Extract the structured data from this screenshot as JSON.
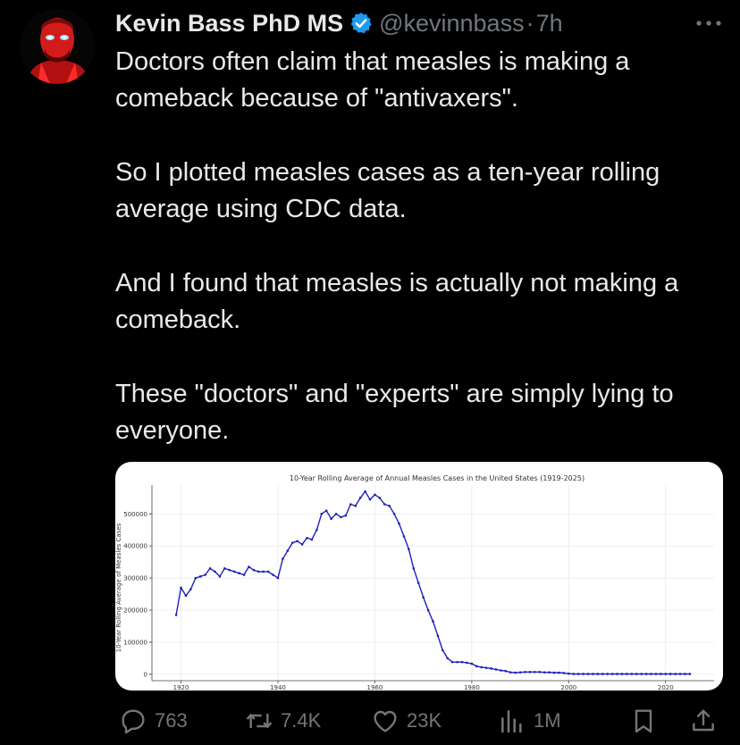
{
  "tweet": {
    "author_name": "Kevin Bass PhD MS",
    "handle": "@kevinnbass",
    "separator": "·",
    "time": "7h",
    "paragraphs": [
      "Doctors often claim that measles is making a comeback because of \"antivaxers\".",
      "So I plotted measles cases as a ten-year rolling average using CDC data.",
      "And I found that measles is actually not making a comeback.",
      "These \"doctors\" and \"experts\" are simply lying to everyone."
    ]
  },
  "actions": {
    "replies": "763",
    "reposts": "7.4K",
    "likes": "23K",
    "views": "1M"
  },
  "icons": {
    "verified": "verified-badge-icon",
    "more": "more-dots-icon",
    "reply": "reply-icon",
    "repost": "repost-icon",
    "like": "heart-icon",
    "views": "views-icon",
    "bookmark": "bookmark-icon",
    "share": "share-icon"
  },
  "colors": {
    "background": "#000000",
    "text": "#e7e9ea",
    "muted": "#71767b",
    "verified": "#1d9bf0",
    "chart_line": "#1f1fbf"
  },
  "chart_data": {
    "type": "line",
    "title": "10-Year Rolling Average of Annual Measles Cases in the United States (1919-2025)",
    "xlabel": "",
    "ylabel": "10-Year Rolling Average of Measles Cases",
    "xlim": [
      1914,
      2030
    ],
    "ylim": [
      -20000,
      590000
    ],
    "x_ticks": [
      1920,
      1940,
      1960,
      1980,
      2000,
      2020
    ],
    "y_ticks": [
      0,
      100000,
      200000,
      300000,
      400000,
      500000
    ],
    "y_tick_labels": [
      "0",
      "100000",
      "200000",
      "300000",
      "400000",
      "500000"
    ],
    "grid": true,
    "marker": "dot",
    "series": [
      {
        "x": [
          1919,
          1920,
          1921,
          1922,
          1923,
          1924,
          1925,
          1926,
          1927,
          1928,
          1929,
          1930,
          1931,
          1932,
          1933,
          1934,
          1935,
          1936,
          1937,
          1938,
          1939,
          1940,
          1941,
          1942,
          1943,
          1944,
          1945,
          1946,
          1947,
          1948,
          1949,
          1950,
          1951,
          1952,
          1953,
          1954,
          1955,
          1956,
          1957,
          1958,
          1959,
          1960,
          1961,
          1962,
          1963,
          1964,
          1965,
          1966,
          1967,
          1968,
          1969,
          1970,
          1971,
          1972,
          1973,
          1974,
          1975,
          1976,
          1977,
          1978,
          1979,
          1980,
          1981,
          1982,
          1983,
          1984,
          1985,
          1986,
          1987,
          1988,
          1989,
          1990,
          1991,
          1992,
          1993,
          1994,
          1995,
          1996,
          1997,
          1998,
          1999,
          2000,
          2001,
          2002,
          2003,
          2004,
          2005,
          2006,
          2007,
          2008,
          2009,
          2010,
          2011,
          2012,
          2013,
          2014,
          2015,
          2016,
          2017,
          2018,
          2019,
          2020,
          2021,
          2022,
          2023,
          2024,
          2025
        ],
        "y": [
          185000,
          270000,
          245000,
          265000,
          300000,
          305000,
          310000,
          330000,
          320000,
          305000,
          330000,
          325000,
          320000,
          315000,
          310000,
          335000,
          325000,
          320000,
          320000,
          320000,
          310000,
          300000,
          360000,
          385000,
          410000,
          415000,
          405000,
          425000,
          420000,
          450000,
          500000,
          510000,
          485000,
          500000,
          490000,
          495000,
          530000,
          525000,
          550000,
          570000,
          545000,
          560000,
          550000,
          530000,
          525000,
          500000,
          470000,
          430000,
          390000,
          330000,
          285000,
          240000,
          200000,
          165000,
          120000,
          75000,
          50000,
          38000,
          38000,
          38000,
          36000,
          33000,
          25000,
          22000,
          20000,
          18000,
          15000,
          12000,
          10000,
          6000,
          5000,
          6000,
          7000,
          7000,
          7000,
          7000,
          6000,
          6000,
          5000,
          5000,
          4000,
          2000,
          1000,
          1000,
          1000,
          1000,
          1000,
          1000,
          1000,
          1000,
          1000,
          1000,
          1000,
          1000,
          1000,
          1000,
          1000,
          1000,
          1000,
          1000,
          1000,
          1000,
          1000,
          1000,
          1000,
          1000,
          1000
        ]
      }
    ]
  }
}
